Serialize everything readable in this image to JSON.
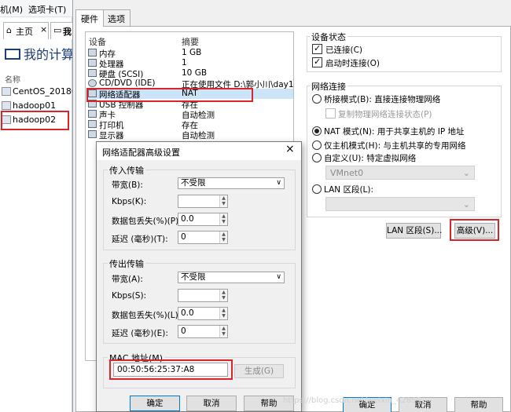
{
  "left_shell": {
    "menu": [
      "机(M)",
      "选项卡(T)"
    ],
    "tabs": [
      "主页",
      "我"
    ],
    "home_title": "我的计算",
    "name_header": "名称",
    "vms": [
      "CentOS_201808",
      "hadoop01",
      "hadoop02"
    ]
  },
  "main": {
    "tabs": [
      "硬件",
      "选项"
    ],
    "device_header": "设备",
    "summary_header": "摘要",
    "devices": [
      {
        "name": "内存",
        "value": "1 GB"
      },
      {
        "name": "处理器",
        "value": "1"
      },
      {
        "name": "硬盘 (SCSI)",
        "value": "10 GB"
      },
      {
        "name": "CD/DVD (IDE)",
        "value": "正在使用文件 D:\\郭小川\\day10..."
      },
      {
        "name": "网络适配器",
        "value": "NAT"
      },
      {
        "name": "USB 控制器",
        "value": "存在"
      },
      {
        "name": "声卡",
        "value": "自动检测"
      },
      {
        "name": "打印机",
        "value": "存在"
      },
      {
        "name": "显示器",
        "value": "自动检测"
      }
    ],
    "device_status": {
      "title": "设备状态",
      "connected": "已连接(C)",
      "connect_on_start": "启动时连接(O)"
    },
    "network": {
      "title": "网络连接",
      "bridged": "桥接模式(B): 直接连接物理网络",
      "replicate": "复制物理网络连接状态(P)",
      "nat": "NAT 模式(N): 用于共享主机的 IP 地址",
      "host_only": "仅主机模式(H): 与主机共享的专用网络",
      "custom": "自定义(U): 特定虚拟网络",
      "vmnet": "VMnet0",
      "lan": "LAN 区段(L):",
      "lan_segment_button": "LAN 区段(S)...",
      "advanced_button": "高级(V)..."
    },
    "buttons": {
      "ok": "确定",
      "cancel": "取消",
      "help": "帮助"
    }
  },
  "advanced": {
    "title": "网络适配器高级设置",
    "close": "×",
    "incoming": {
      "title": "传入传输",
      "bandwidth_label": "带宽(B):",
      "bandwidth_value": "不受限",
      "kbps_label": "Kbps(K):",
      "kbps_value": "",
      "loss_label": "数据包丢失(%)(P)",
      "loss_value": "0.0",
      "latency_label": "延迟 (毫秒)(T):",
      "latency_value": "0"
    },
    "outgoing": {
      "title": "传出传输",
      "bandwidth_label": "带宽(A):",
      "bandwidth_value": "不受限",
      "kbps_label": "Kbps(S):",
      "kbps_value": "",
      "loss_label": "数据包丢失(%)(L):",
      "loss_value": "0.0",
      "latency_label": "延迟 (毫秒)(E):",
      "latency_value": "0"
    },
    "mac_label": "MAC 地址(M)",
    "mac_value": "00:50:56:25:37:A8",
    "generate_button": "生成(G)",
    "buttons": {
      "ok": "确定",
      "cancel": "取消",
      "help": "帮助"
    }
  },
  "watermark": "https://blog.csdn.net/weixin_42855"
}
